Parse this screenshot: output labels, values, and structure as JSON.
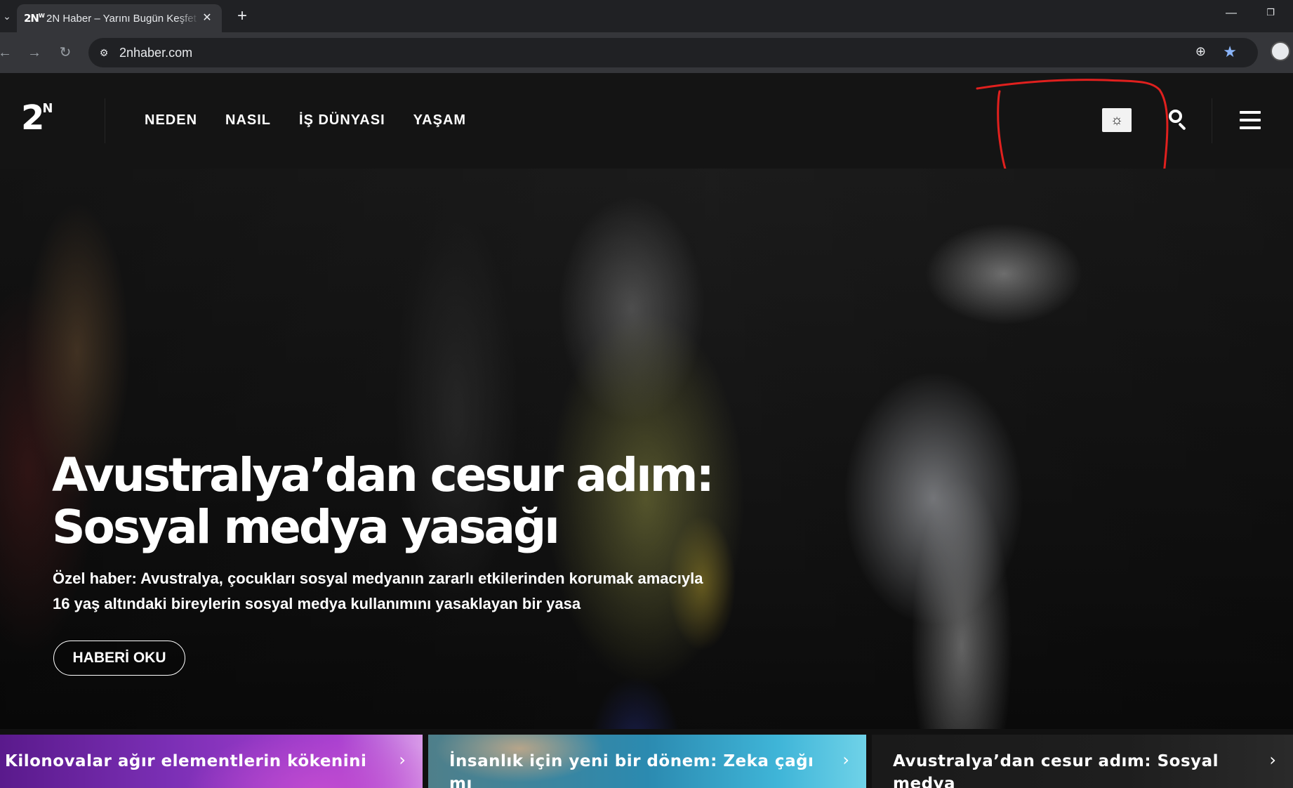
{
  "browser": {
    "tab": {
      "favicon": "2N",
      "favicon_sup": "W",
      "title": "2N Haber – Yarını Bugün Keşfet",
      "close_icon": "close-icon"
    },
    "new_tab_label": "+",
    "url": "2nhaber.com",
    "icons": [
      "back-icon",
      "forward-icon",
      "reload-icon",
      "site-info-icon",
      "zoom-icon",
      "bookmark-star-icon",
      "profile-icon",
      "minimize-icon",
      "restore-icon"
    ]
  },
  "header": {
    "logo": {
      "main": "2",
      "sup": "N"
    },
    "nav": [
      {
        "label": "NEDEN"
      },
      {
        "label": "NASIL"
      },
      {
        "label": "İŞ DÜNYASI"
      },
      {
        "label": "YAŞAM"
      }
    ],
    "icons": [
      "sun-icon",
      "search-icon",
      "hamburger-menu-icon"
    ]
  },
  "hero": {
    "title_line1": "Avustralya’dan cesur adım:",
    "title_line2": "Sosyal medya yasağı",
    "summary_line1": "Özel haber: Avustralya, çocukları sosyal medyanın zararlı etkilerinden korumak amacıyla",
    "summary_line2": "16 yaş altındaki bireylerin sosyal medya kullanımını yasaklayan bir yasa",
    "cta_label": "HABERİ OKU"
  },
  "cards": [
    {
      "title": "Kilonovalar ağır elementlerin kökenini"
    },
    {
      "title": "İnsanlık için yeni bir dönem: Zeka çağı mı"
    },
    {
      "title": "Avustralya’dan cesur adım: Sosyal medya"
    }
  ],
  "colors": {
    "header_bg": "#141414",
    "tabbar_bg": "#202124",
    "toolbar_bg": "#35363a",
    "annotation_red": "#e0201e",
    "accent_star": "#8ab4f8"
  }
}
